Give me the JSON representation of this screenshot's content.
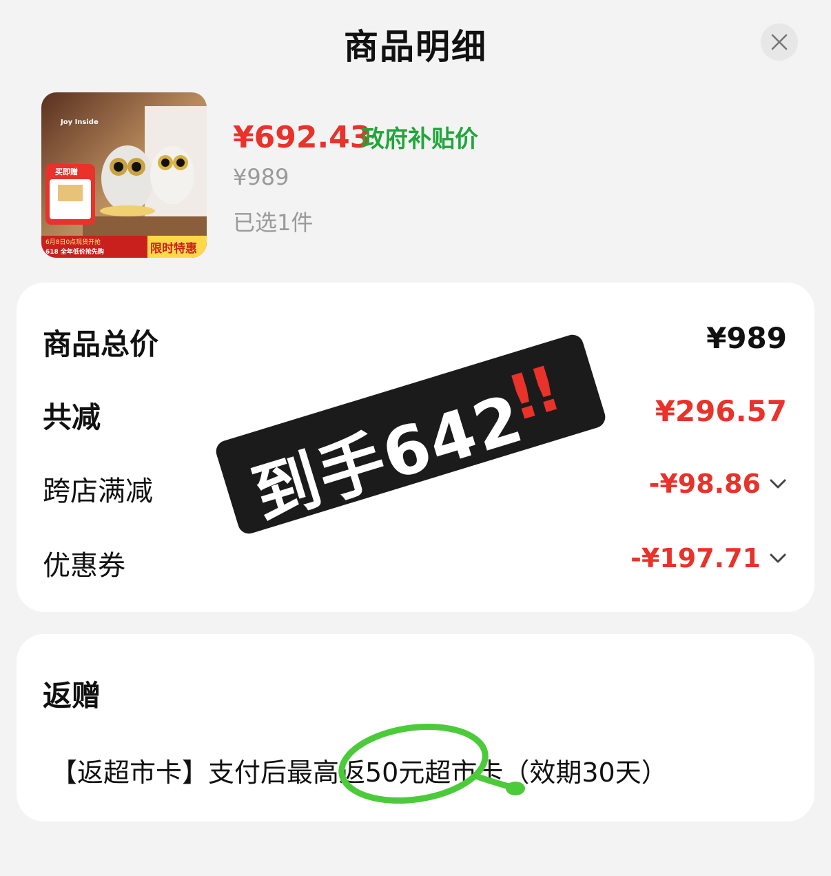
{
  "header": {
    "title": "商品明细"
  },
  "product": {
    "price_now": "¥692.43",
    "price_tag": "政府补贴价",
    "price_original": "¥989",
    "selected": "已选1件",
    "image": {
      "top_brand": "Joy Inside",
      "badge": "买即赠",
      "banner_left_top": "6月8日0点现货开抢",
      "banner_left_bottom": "618 全年低价抢先购",
      "banner_right": "限时特惠"
    }
  },
  "summary": {
    "total_label": "商品总价",
    "total_value": "¥989",
    "discount_label": "共减",
    "discount_value": "¥296.57",
    "cross_store_label": "跨店满减",
    "cross_store_value": "-¥98.86",
    "coupon_label": "优惠券",
    "coupon_value": "-¥197.71"
  },
  "gift": {
    "title": "返赠",
    "text": "【返超市卡】支付后最高返50元超市卡（效期30天）"
  },
  "sticker": {
    "text": "到手642",
    "exclaim": "!!"
  },
  "colors": {
    "red": "#e8322a",
    "green": "#22a53a",
    "gray": "#9a9a9a"
  }
}
